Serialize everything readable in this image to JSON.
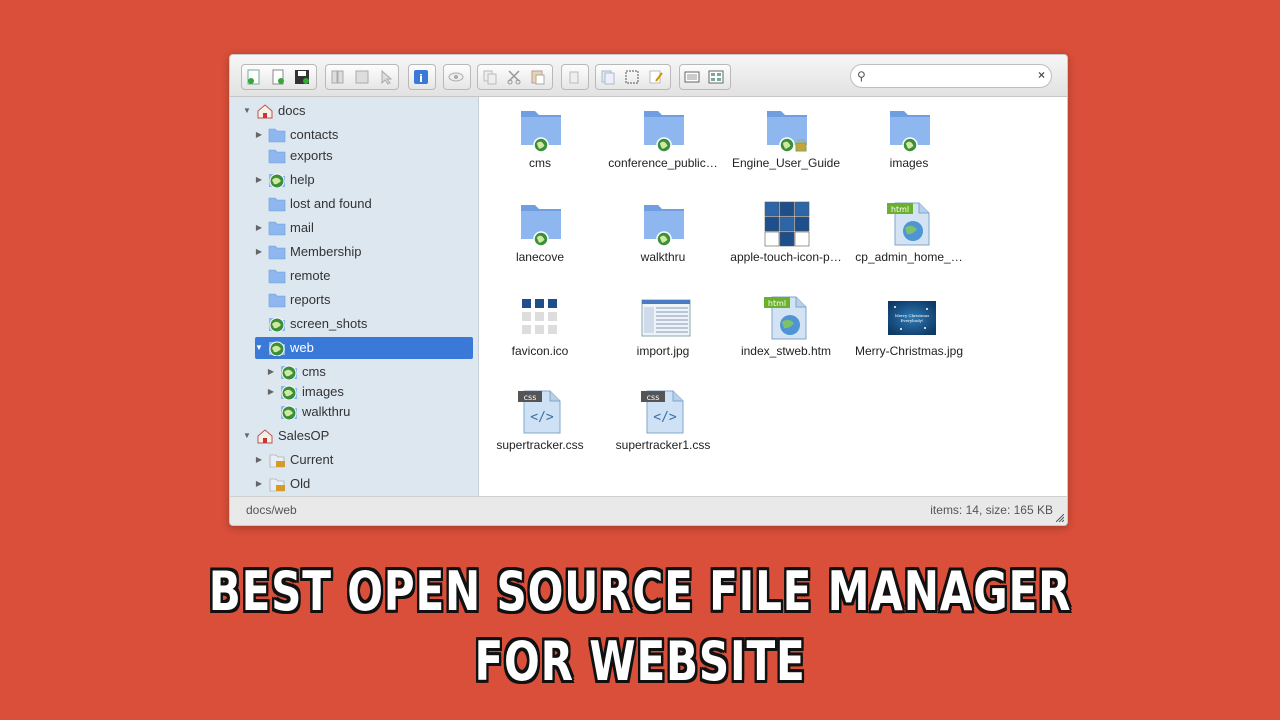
{
  "search": {
    "placeholder": ""
  },
  "tree": [
    {
      "label": "docs",
      "arrow": "▼",
      "icon": "home",
      "level": 0
    },
    {
      "label": "contacts",
      "arrow": "▶",
      "icon": "folder",
      "level": 1
    },
    {
      "label": "exports",
      "arrow": "",
      "icon": "folder",
      "level": 1
    },
    {
      "label": "help",
      "arrow": "▶",
      "icon": "globe",
      "level": 1
    },
    {
      "label": "lost and found",
      "arrow": "",
      "icon": "folder",
      "level": 1
    },
    {
      "label": "mail",
      "arrow": "▶",
      "icon": "folder",
      "level": 1
    },
    {
      "label": "Membership",
      "arrow": "▶",
      "icon": "folder",
      "level": 1
    },
    {
      "label": "remote",
      "arrow": "",
      "icon": "folder",
      "level": 1
    },
    {
      "label": "reports",
      "arrow": "",
      "icon": "folder",
      "level": 1
    },
    {
      "label": "screen_shots",
      "arrow": "",
      "icon": "globe",
      "level": 1
    },
    {
      "label": "web",
      "arrow": "▼",
      "icon": "globe",
      "level": 1,
      "selected": true
    },
    {
      "label": "cms",
      "arrow": "▶",
      "icon": "globe",
      "level": 2
    },
    {
      "label": "images",
      "arrow": "▶",
      "icon": "globe",
      "level": 2
    },
    {
      "label": "walkthru",
      "arrow": "",
      "icon": "globe",
      "level": 2
    },
    {
      "label": "SalesOP",
      "arrow": "▼",
      "icon": "home",
      "level": 0
    },
    {
      "label": "Current",
      "arrow": "▶",
      "icon": "css",
      "level": 1
    },
    {
      "label": "Old",
      "arrow": "▶",
      "icon": "css",
      "level": 1
    }
  ],
  "files": [
    {
      "name": "cms",
      "kind": "folder-globe"
    },
    {
      "name": "conference_public…",
      "kind": "folder-globe"
    },
    {
      "name": "Engine_User_Guide",
      "kind": "folder-lock"
    },
    {
      "name": "images",
      "kind": "folder-globe"
    },
    {
      "name": "lanecove",
      "kind": "folder-globe"
    },
    {
      "name": "walkthru",
      "kind": "folder-globe"
    },
    {
      "name": "apple-touch-icon-p…",
      "kind": "image-grid"
    },
    {
      "name": "cp_admin_home_…",
      "kind": "html"
    },
    {
      "name": "favicon.ico",
      "kind": "image-grid-small"
    },
    {
      "name": "import.jpg",
      "kind": "screenshot"
    },
    {
      "name": "index_stweb.htm",
      "kind": "html"
    },
    {
      "name": "Merry-Christmas.jpg",
      "kind": "christmas"
    },
    {
      "name": "supertracker.css",
      "kind": "css"
    },
    {
      "name": "supertracker1.css",
      "kind": "css"
    }
  ],
  "badges": {
    "html": "html",
    "css": "css"
  },
  "christmas_text": "Merry Christmas Everybody!",
  "status": {
    "path": "docs/web",
    "info": "items: 14, size: 165 KB"
  },
  "headline": {
    "line1": "BEST OPEN SOURCE FILE MANAGER",
    "line2": "FOR WEBSITE"
  },
  "colors": {
    "background": "#d94f3a",
    "selection": "#3a79d8",
    "tree_bg": "#dde7f0",
    "folder": "#6f9fe0"
  }
}
